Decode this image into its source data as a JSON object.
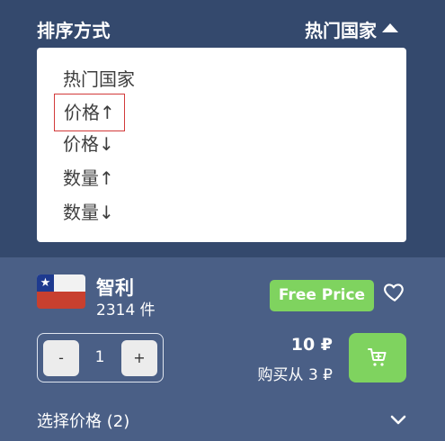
{
  "sort": {
    "label": "排序方式",
    "current": "热门国家",
    "options": [
      "热门国家",
      "价格↑",
      "价格↓",
      "数量↑",
      "数量↓"
    ]
  },
  "product": {
    "country": "智利",
    "count": "2314 件",
    "badge": "Free Price",
    "quantity": "1",
    "minus_label": "-",
    "plus_label": "+",
    "price": "10 ₽",
    "buy_from": "购买从 3 ₽",
    "choose_price": "选择价格 (2)"
  },
  "colors": {
    "header_bg": "#34496d",
    "panel_bg": "#4a5f86",
    "accent_green": "#7fd35f",
    "highlight_border": "#d23a3a"
  }
}
